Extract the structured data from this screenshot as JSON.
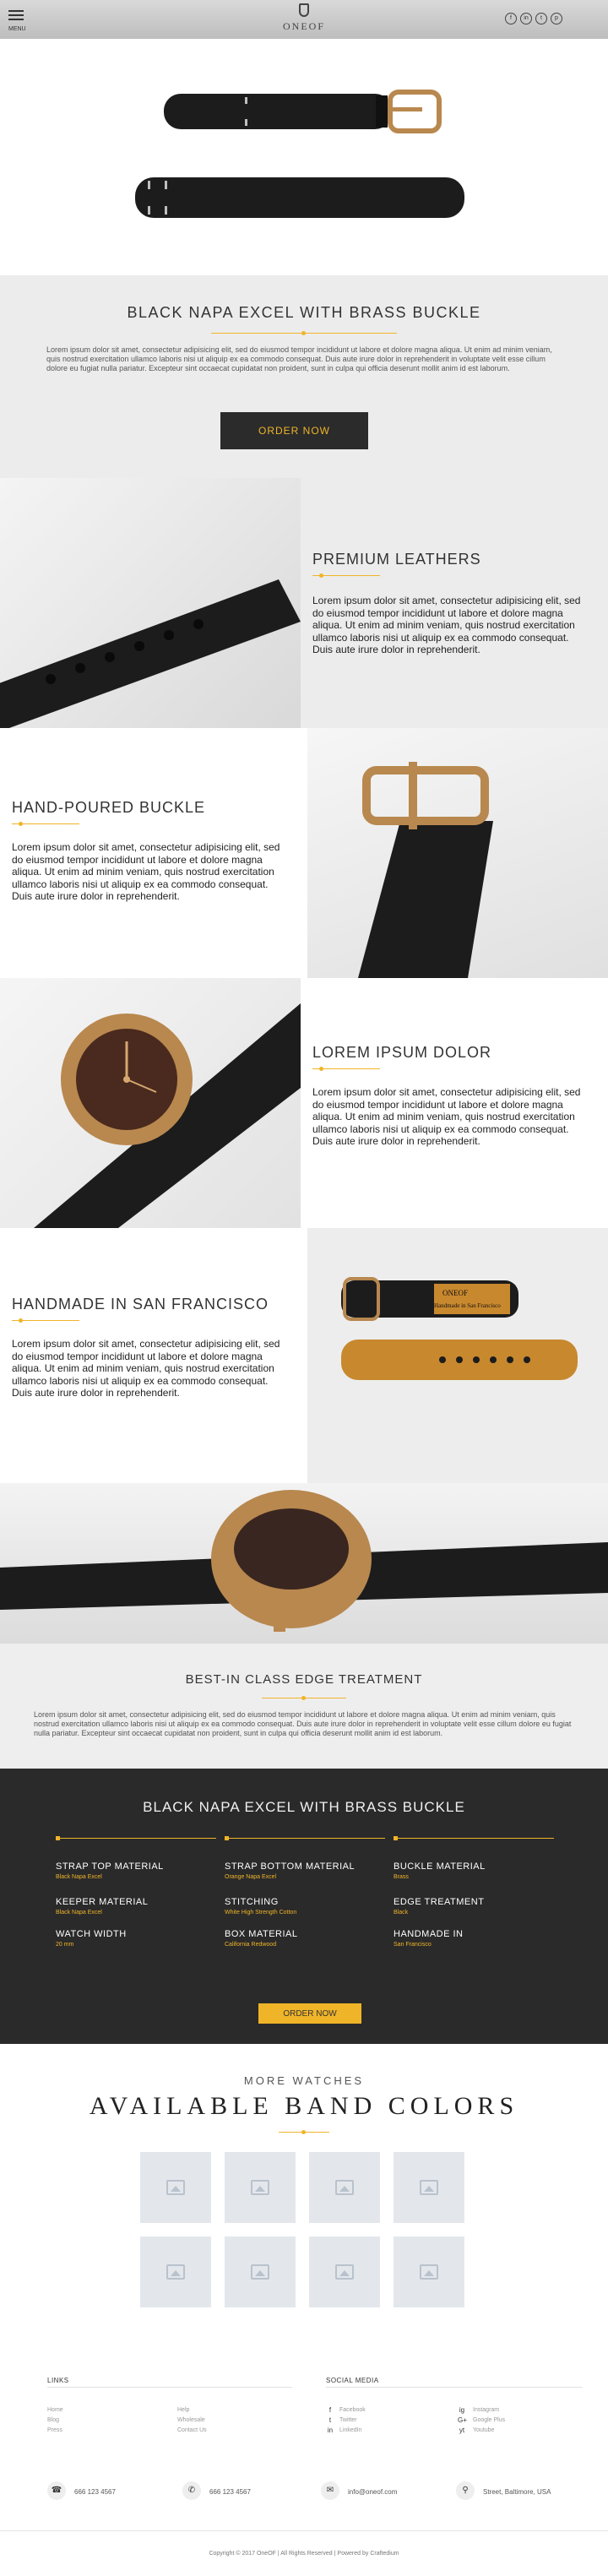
{
  "header": {
    "menu_label": "MENU",
    "logo_text": "ONEOF",
    "socials": [
      {
        "icon": "facebook-icon",
        "glyph": "f"
      },
      {
        "icon": "linkedin-icon",
        "glyph": "in"
      },
      {
        "icon": "twitter-icon",
        "glyph": "t"
      },
      {
        "icon": "pinterest-icon",
        "glyph": "p"
      }
    ]
  },
  "intro": {
    "title": "BLACK NAPA EXCEL WITH BRASS BUCKLE",
    "text": "Lorem ipsum dolor sit amet, consectetur adipisicing elit, sed do eiusmod tempor incididunt ut labore et dolore magna aliqua. Ut enim ad minim veniam, quis nostrud exercitation ullamco laboris nisi ut aliquip ex ea commodo consequat. Duis aute irure dolor in reprehenderit in voluptate velit esse cillum dolore eu fugiat nulla pariatur. Excepteur sint occaecat cupidatat non proident, sunt in culpa qui officia deserunt mollit anim id est laborum.",
    "order_label": "ORDER NOW"
  },
  "features": [
    {
      "title": "PREMIUM LEATHERS",
      "text": "Lorem ipsum dolor sit amet, consectetur adipisicing elit, sed do eiusmod tempor incididunt ut labore et dolore magna aliqua. Ut enim ad minim veniam, quis nostrud exercitation ullamco laboris nisi ut aliquip ex ea commodo consequat. Duis aute irure dolor in reprehenderit."
    },
    {
      "title": "HAND-POURED BUCKLE",
      "text": "Lorem ipsum dolor sit amet, consectetur adipisicing elit, sed do eiusmod tempor incididunt ut labore et dolore magna aliqua. Ut enim ad minim veniam, quis nostrud exercitation ullamco laboris nisi ut aliquip ex ea commodo consequat. Duis aute irure dolor in reprehenderit."
    },
    {
      "title": "LOREM IPSUM DOLOR",
      "text": "Lorem ipsum dolor sit amet, consectetur adipisicing elit, sed do eiusmod tempor incididunt ut labore et dolore magna aliqua. Ut enim ad minim veniam, quis nostrud exercitation ullamco laboris nisi ut aliquip ex ea commodo consequat. Duis aute irure dolor in reprehenderit."
    },
    {
      "title": "HANDMADE IN SAN FRANCISCO",
      "text": "Lorem ipsum dolor sit amet, consectetur adipisicing elit, sed do eiusmod tempor incididunt ut labore et dolore magna aliqua. Ut enim ad minim veniam, quis nostrud exercitation ullamco laboris nisi ut aliquip ex ea commodo consequat. Duis aute irure dolor in reprehenderit."
    }
  ],
  "stamp_text": {
    "line1": "ONEOF",
    "line2": "Handmade in San Francisco"
  },
  "edge": {
    "title": "BEST-IN CLASS EDGE TREATMENT",
    "text": "Lorem ipsum dolor sit amet, consectetur adipisicing elit, sed do eiusmod tempor incididunt ut labore et dolore magna aliqua. Ut enim ad minim veniam, quis nostrud exercitation ullamco laboris nisi ut aliquip ex ea commodo consequat. Duis aute irure dolor in reprehenderit in voluptate velit esse cillum dolore eu fugiat nulla pariatur. Excepteur sint occaecat cupidatat non proident, sunt in culpa qui officia deserunt mollit anim id est laborum."
  },
  "specs": {
    "title": "BLACK NAPA EXCEL WITH BRASS BUCKLE",
    "items": [
      {
        "k": "STRAP TOP MATERIAL",
        "v": "Black Napa Excel"
      },
      {
        "k": "STRAP BOTTOM MATERIAL",
        "v": "Orange Napa Excel"
      },
      {
        "k": "BUCKLE MATERIAL",
        "v": "Brass"
      },
      {
        "k": "KEEPER MATERIAL",
        "v": "Black Napa Excel"
      },
      {
        "k": "STITCHING",
        "v": "White High Strength Cotton"
      },
      {
        "k": "EDGE TREATMENT",
        "v": "Black"
      },
      {
        "k": "WATCH WIDTH",
        "v": "20 mm"
      },
      {
        "k": "BOX MATERIAL",
        "v": "California Redwood"
      },
      {
        "k": "HANDMADE IN",
        "v": "San Francisco"
      }
    ],
    "order_label": "ORDER NOW"
  },
  "more": {
    "subtitle": "MORE WATCHES",
    "title": "AVAILABLE BAND COLORS",
    "thumb_icon": "image-placeholder-icon"
  },
  "footer": {
    "links_title": "LINKS",
    "links": [
      "Home",
      "Blog",
      "Press",
      "Help",
      "Wholesale",
      "Contact Us"
    ],
    "social_title": "SOCIAL MEDIA",
    "social_links": [
      {
        "glyph": "f",
        "label": "Facebook"
      },
      {
        "glyph": "ig",
        "label": "Instagram"
      },
      {
        "glyph": "t",
        "label": "Twitter"
      },
      {
        "glyph": "G+",
        "label": "Google Plus"
      },
      {
        "glyph": "in",
        "label": "LinkedIn"
      },
      {
        "glyph": "yt",
        "label": "Youtube"
      }
    ],
    "contacts": [
      {
        "glyph": "☎",
        "text": "666 123 4567"
      },
      {
        "glyph": "✆",
        "text": "666 123 4567"
      },
      {
        "glyph": "✉",
        "text": "info@oneof.com"
      },
      {
        "glyph": "⚲",
        "text": "Street, Baltimore, USA"
      }
    ],
    "copyright": "Copyright © 2017 OneOF   |   All Rights Reserved   |   Powered by Craftedium"
  },
  "colors": {
    "accent": "#f0b429",
    "dark": "#2a2a2a",
    "strap": "#1c1c1c",
    "brass": "#b8884f"
  }
}
